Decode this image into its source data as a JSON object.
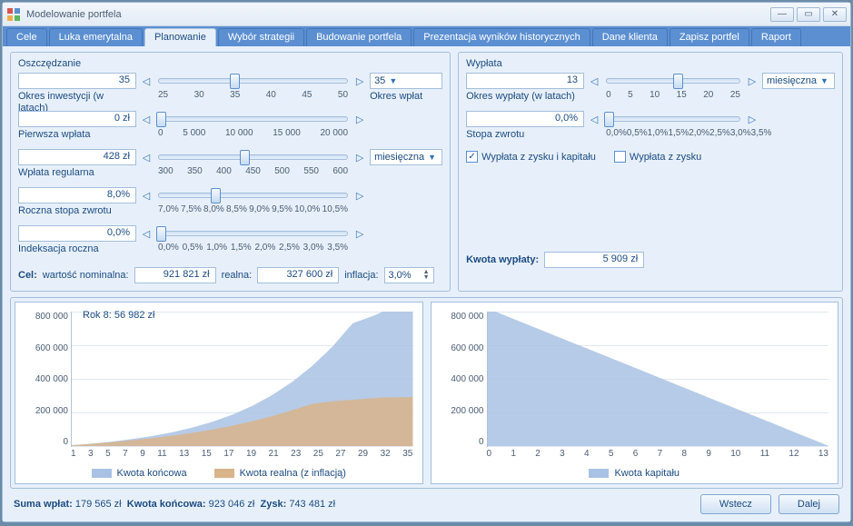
{
  "window": {
    "title": "Modelowanie portfela"
  },
  "tabs": [
    "Cele",
    "Luka emerytalna",
    "Planowanie",
    "Wybór strategii",
    "Budowanie portfela",
    "Prezentacja wyników historycznych",
    "Dane klienta",
    "Zapisz portfel",
    "Raport"
  ],
  "active_tab": 2,
  "saving": {
    "title": "Oszczędzanie",
    "period_value": "35",
    "period_label": "Okres inwestycji (w latach)",
    "period_ticks": [
      "25",
      "30",
      "35",
      "40",
      "45",
      "50"
    ],
    "period_dd_value": "35",
    "period_side_label": "Okres wpłat",
    "first_value": "0 zł",
    "first_label": "Pierwsza wpłata",
    "first_ticks": [
      "0",
      "5 000",
      "10 000",
      "15 000",
      "20 000"
    ],
    "regular_value": "428 zł",
    "regular_label": "Wpłata regularna",
    "regular_ticks": [
      "300",
      "350",
      "400",
      "450",
      "500",
      "550",
      "600"
    ],
    "regular_dd_value": "miesięczna",
    "rate_value": "8,0%",
    "rate_label": "Roczna stopa zwrotu",
    "rate_ticks": [
      "7,0%",
      "7,5%",
      "8,0%",
      "8,5%",
      "9,0%",
      "9,5%",
      "10,0%",
      "10,5%"
    ],
    "index_value": "0,0%",
    "index_label": "Indeksacja roczna",
    "index_ticks": [
      "0,0%",
      "0,5%",
      "1,0%",
      "1,5%",
      "2,0%",
      "2,5%",
      "3,0%",
      "3,5%"
    ],
    "goal_prefix": "Cel:",
    "goal_nominal_label": "wartość nominalna:",
    "goal_nominal_value": "921 821 zł",
    "goal_real_label": "realna:",
    "goal_real_value": "327 600 zł",
    "goal_inflation_label": "inflacja:",
    "goal_inflation_value": "3,0%"
  },
  "payout": {
    "title": "Wypłata",
    "period_value": "13",
    "period_label": "Okres wypłaty (w latach)",
    "period_ticks": [
      "0",
      "5",
      "10",
      "15",
      "20",
      "25"
    ],
    "period_dd_value": "miesięczna",
    "rate_value": "0,0%",
    "rate_label": "Stopa zwrotu",
    "rate_ticks": [
      "0,0%",
      "0,5%",
      "1,0%",
      "1,5%",
      "2,0%",
      "2,5%",
      "3,0%",
      "3,5%"
    ],
    "cb_both": "Wypłata z zysku i kapitału",
    "cb_profit": "Wypłata z zysku",
    "result_label": "Kwota wypłaty:",
    "result_value": "5 909 zł"
  },
  "chart_data": [
    {
      "type": "area",
      "annotation": "Rok 8: 56 982 zł",
      "x": [
        1,
        3,
        5,
        7,
        8,
        9,
        11,
        13,
        15,
        17,
        19,
        21,
        23,
        25,
        27,
        29,
        31,
        32,
        35
      ],
      "series": [
        {
          "name": "Kwota końcowa",
          "color": "#a9c2e3",
          "values": [
            5000,
            16000,
            30000,
            47000,
            56982,
            67000,
            92000,
            123000,
            162000,
            210000,
            269000,
            342000,
            431000,
            538000,
            667000,
            822000,
            870000,
            900000,
            921000
          ]
        },
        {
          "name": "Kwota realna (z inflacją)",
          "color": "#d8b48a",
          "values": [
            5000,
            15000,
            26000,
            39000,
            46000,
            53000,
            69000,
            88000,
            110000,
            136000,
            166000,
            201000,
            240000,
            283000,
            300000,
            310000,
            320000,
            325000,
            327600
          ]
        }
      ],
      "ylim": [
        0,
        900000
      ],
      "y_ticks": [
        "800 000",
        "600 000",
        "400 000",
        "200 000",
        "0"
      ],
      "x_ticks": [
        "1",
        "3",
        "5",
        "7",
        "9",
        "11",
        "13",
        "15",
        "17",
        "19",
        "21",
        "23",
        "25",
        "27",
        "29",
        "32",
        "35"
      ],
      "legend": [
        "Kwota końcowa",
        "Kwota realna (z inflacją)"
      ]
    },
    {
      "type": "area",
      "x": [
        0,
        1,
        2,
        3,
        4,
        5,
        6,
        7,
        8,
        9,
        10,
        11,
        12,
        13
      ],
      "series": [
        {
          "name": "Kwota kapitału",
          "color": "#a9c2e3",
          "values": [
            921000,
            850000,
            779000,
            708000,
            638000,
            567000,
            496000,
            425000,
            354000,
            283000,
            213000,
            142000,
            71000,
            0
          ]
        }
      ],
      "ylim": [
        0,
        900000
      ],
      "y_ticks": [
        "800 000",
        "600 000",
        "400 000",
        "200 000",
        "0"
      ],
      "x_ticks": [
        "0",
        "1",
        "2",
        "3",
        "4",
        "5",
        "6",
        "7",
        "8",
        "9",
        "10",
        "11",
        "12",
        "13"
      ],
      "legend": [
        "Kwota kapitału"
      ]
    }
  ],
  "footer": {
    "sum_label": "Suma wpłat:",
    "sum_value": "179 565 zł",
    "final_label": "Kwota końcowa:",
    "final_value": "923 046 zł",
    "profit_label": "Zysk:",
    "profit_value": "743 481 zł",
    "back": "Wstecz",
    "next": "Dalej"
  }
}
